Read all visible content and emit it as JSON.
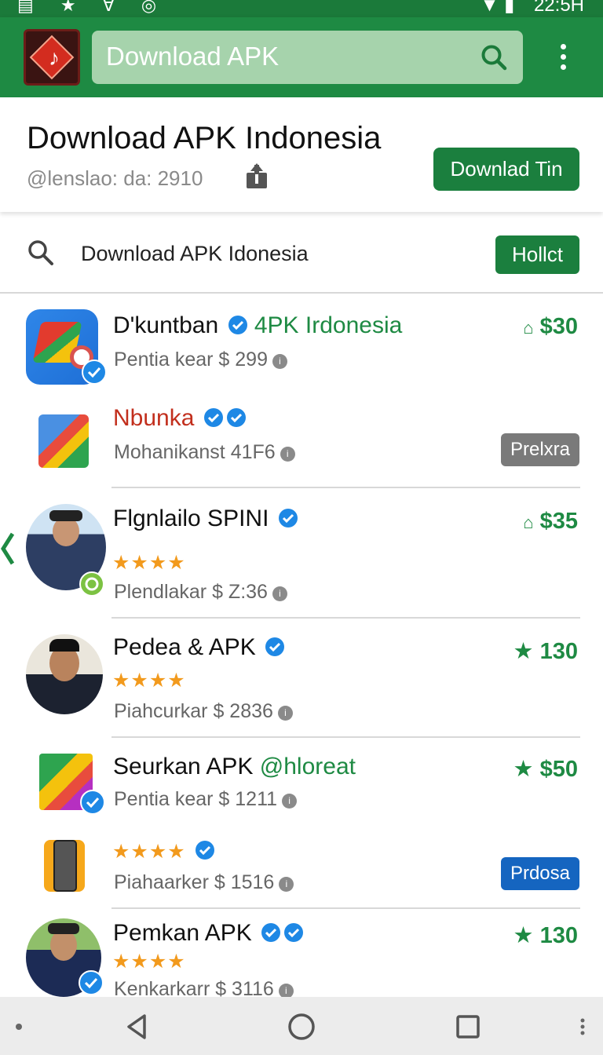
{
  "status_bar": {
    "left_icons": "▤ ★ ∀ ◎",
    "right_icons": "▼ ▮",
    "time": "22:5H"
  },
  "app_bar": {
    "search_value": "Download APK",
    "search_icon": "search-icon",
    "menu_icon": "overflow-menu-icon"
  },
  "header": {
    "title": "Download APK Indonesia",
    "subline": "@lenslao: da: 2910",
    "share_icon": "share-icon",
    "button_label": "Downlad Tin"
  },
  "search_row": {
    "query": "Download APK Idonesia",
    "button_label": "Hollct"
  },
  "items": [
    {
      "title": "D'kuntban",
      "title_extra": "4PK Irdonesia",
      "sub": "Pentia kear $ 299",
      "price": "$30",
      "price_icon": "store-icon",
      "verified_count": 1
    },
    {
      "title": "Nbunka",
      "title_extra": "",
      "sub": "Mohanikanst 41F6",
      "button": "Prelxra",
      "verified_count": 2
    },
    {
      "title": "Flgnlailo SPINI",
      "title_extra": "",
      "stars": "★★★★",
      "sub": "Plendlakar $ Z:36",
      "price": "$35",
      "price_icon": "store-icon",
      "verified_count": 1
    },
    {
      "title": "Pedea & APK",
      "title_extra": "",
      "stars": "★★★★",
      "sub": "Piahcurkar $ 2836",
      "price": "130",
      "price_icon": "star-icon",
      "verified_count": 1
    },
    {
      "title": "Seurkan APK",
      "title_extra": "@hloreat",
      "sub": "Pentia kear $ 1211",
      "price": "$50",
      "price_icon": "star-icon",
      "verified_count": 0
    },
    {
      "title": "",
      "title_extra": "",
      "stars": "★★★★",
      "sub": "Piahaarker $ 1516",
      "button": "Prdosa",
      "verified_count": 1
    },
    {
      "title": "Pemkan APK",
      "title_extra": "",
      "stars": "★★★★",
      "sub": "Kenkarkarr $ 3116",
      "price": "130",
      "price_icon": "star-icon",
      "verified_count": 2
    }
  ],
  "nav_bar": {
    "icons": [
      "dot-icon",
      "back-icon",
      "home-icon",
      "recents-icon",
      "more-icon"
    ]
  },
  "colors": {
    "primary": "#1e8a43",
    "accent_red": "#c22f1d",
    "verified_blue": "#1e88e5",
    "star_orange": "#f29a1d"
  }
}
